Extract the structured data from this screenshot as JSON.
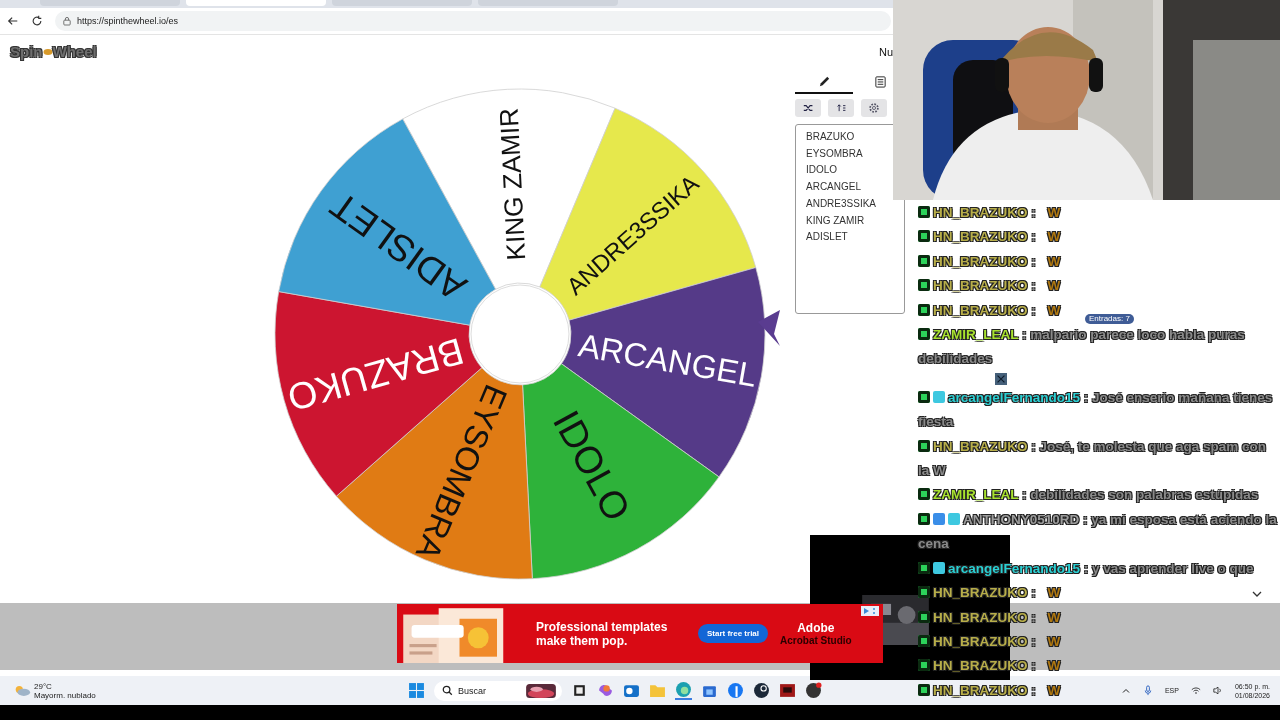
{
  "browser": {
    "tabs": [
      {
        "selected": false
      },
      {
        "selected": true
      },
      {
        "selected": false
      },
      {
        "selected": false
      }
    ],
    "url": "https://spinthewheel.io/es"
  },
  "site": {
    "logo_left": "Spin",
    "logo_right": "Wheel",
    "header_cut": "Nu"
  },
  "wheel": {
    "slices": [
      {
        "label": "KING ZAMIR",
        "color": "#ffffff"
      },
      {
        "label": "ANDRE3SSIKA",
        "color": "#e6e84c"
      },
      {
        "label": "ARCANGEL",
        "color": "#553a88"
      },
      {
        "label": "IDOLO",
        "color": "#2eb23a"
      },
      {
        "label": "EYSOMBRA",
        "color": "#e07b14"
      },
      {
        "label": "BRAZUKO",
        "color": "#cc1530"
      },
      {
        "label": "ADISLET",
        "color": "#3fa0d2"
      }
    ]
  },
  "editor": {
    "tabs": [
      {
        "kind": "edit",
        "selected": true
      },
      {
        "kind": "results",
        "selected": false
      }
    ],
    "entries": [
      "BRAZUKO",
      "EYSOMBRA",
      "IDOLO",
      "ARCANGEL",
      "ANDRE3SSIKA",
      "KING ZAMIR",
      "ADISLET"
    ],
    "tooltip": "Entradas: 7"
  },
  "ad": {
    "headline": "Professional templates make them pop.",
    "button": "Start free trial",
    "brand": "Adobe",
    "product": "Acrobat Studio"
  },
  "chat": [
    {
      "badges": [
        {
          "kind": "kick"
        }
      ],
      "user": "HN_BRAZUKO",
      "color": "#b8ae4a",
      "separator": ":",
      "message": "W",
      "kind": "emote"
    },
    {
      "badges": [
        {
          "kind": "kick"
        }
      ],
      "user": "HN_BRAZUKO",
      "color": "#b8ae4a",
      "separator": ":",
      "message": "W",
      "kind": "emote"
    },
    {
      "badges": [
        {
          "kind": "kick"
        }
      ],
      "user": "HN_BRAZUKO",
      "color": "#b8ae4a",
      "separator": ":",
      "message": "W",
      "kind": "emote"
    },
    {
      "badges": [
        {
          "kind": "kick"
        }
      ],
      "user": "HN_BRAZUKO",
      "color": "#b8ae4a",
      "separator": ":",
      "message": "W",
      "kind": "emote"
    },
    {
      "badges": [
        {
          "kind": "kick"
        }
      ],
      "user": "HN_BRAZUKO",
      "color": "#b8ae4a",
      "separator": ":",
      "message": "W",
      "kind": "emote"
    },
    {
      "badges": [
        {
          "kind": "kick"
        }
      ],
      "user": "ZAMIR_LEAL",
      "color": "#a8e22e",
      "separator": ":",
      "message": "malpario parece loco habla puras debilidades",
      "kind": "text"
    },
    {
      "badges": [
        {
          "kind": "kick"
        },
        {
          "kind": "sub"
        }
      ],
      "user": "arcangelFernando15",
      "color": "#2ad0d4",
      "separator": ":",
      "message": "José enserio mañana tienes fiesta",
      "kind": "text"
    },
    {
      "badges": [
        {
          "kind": "kick"
        }
      ],
      "user": "HN_BRAZUKO",
      "color": "#b8ae4a",
      "separator": ":",
      "message": "José, te molesta que aga spam con la W",
      "kind": "text"
    },
    {
      "badges": [
        {
          "kind": "kick"
        }
      ],
      "user": "ZAMIR_LEAL",
      "color": "#a8e22e",
      "separator": ":",
      "message": "debilidades son palabras estúpidas",
      "kind": "text"
    },
    {
      "badges": [
        {
          "kind": "kick"
        },
        {
          "kind": "gift"
        },
        {
          "kind": "sub"
        }
      ],
      "user": "ANTHONY0510RD",
      "color": "#9c9c9c",
      "separator": ":",
      "message": "ya mi esposa está aciendo la cena",
      "kind": "text"
    },
    {
      "badges": [
        {
          "kind": "kick"
        },
        {
          "kind": "sub"
        }
      ],
      "user": "arcangelFernando15",
      "color": "#2ad0d4",
      "separator": ":",
      "message": "y vas aprender live o que",
      "kind": "text"
    },
    {
      "badges": [
        {
          "kind": "kick"
        }
      ],
      "user": "HN_BRAZUKO",
      "color": "#b8ae4a",
      "separator": ":",
      "message": "W",
      "kind": "emote"
    },
    {
      "badges": [
        {
          "kind": "kick"
        }
      ],
      "user": "HN_BRAZUKO",
      "color": "#b8ae4a",
      "separator": ":",
      "message": "W",
      "kind": "emote"
    },
    {
      "badges": [
        {
          "kind": "kick"
        }
      ],
      "user": "HN_BRAZUKO",
      "color": "#b8ae4a",
      "separator": ":",
      "message": "W",
      "kind": "emote"
    },
    {
      "badges": [
        {
          "kind": "kick"
        }
      ],
      "user": "HN_BRAZUKO",
      "color": "#b8ae4a",
      "separator": ":",
      "message": "W",
      "kind": "emote"
    },
    {
      "badges": [
        {
          "kind": "kick"
        }
      ],
      "user": "HN_BRAZUKO",
      "color": "#b8ae4a",
      "separator": ":",
      "message": "W",
      "kind": "emote"
    }
  ],
  "taskbar": {
    "temperature": "29°C",
    "condition": "Mayorm. nublado",
    "search_placeholder": "Buscar",
    "language": "ESP",
    "time": "06:50 p. m.",
    "date": "01/08/2026"
  }
}
